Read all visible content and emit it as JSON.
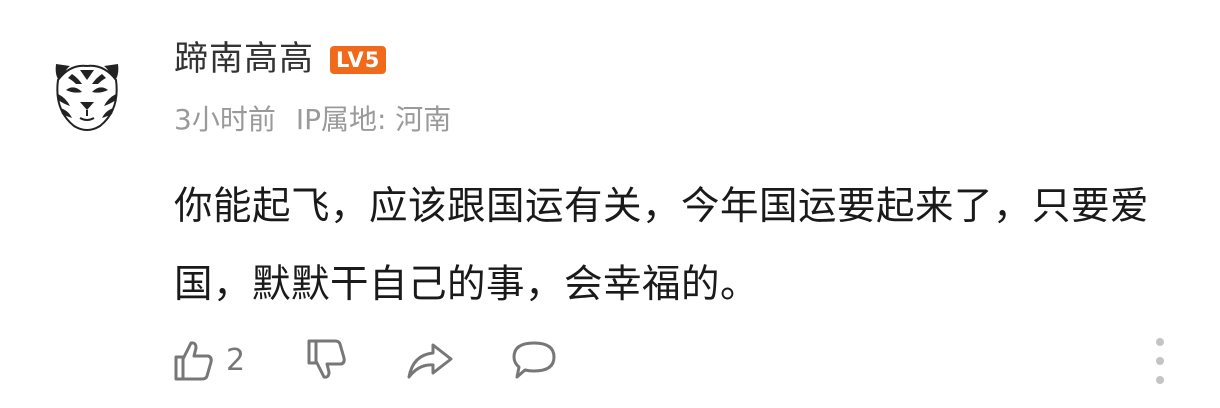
{
  "comment": {
    "username": "蹄南高高",
    "level_badge": "LV5",
    "time": "3小时前",
    "ip_location": "IP属地: 河南",
    "text": "你能起飞，应该跟国运有关，今年国运要起来了，只要爱国，默默干自己的事，会幸福的。",
    "avatar_icon": "tiger-face-icon"
  },
  "actions": {
    "like_count": "2",
    "like_icon": "thumbs-up-icon",
    "dislike_icon": "thumbs-down-icon",
    "share_icon": "share-arrow-icon",
    "reply_icon": "comment-bubble-icon",
    "more_icon": "more-vertical-icon"
  },
  "colors": {
    "badge": "#f06a1c",
    "username": "#333333",
    "meta": "#9a9a9a",
    "content": "#1a1a1a",
    "icons": "#777777"
  }
}
